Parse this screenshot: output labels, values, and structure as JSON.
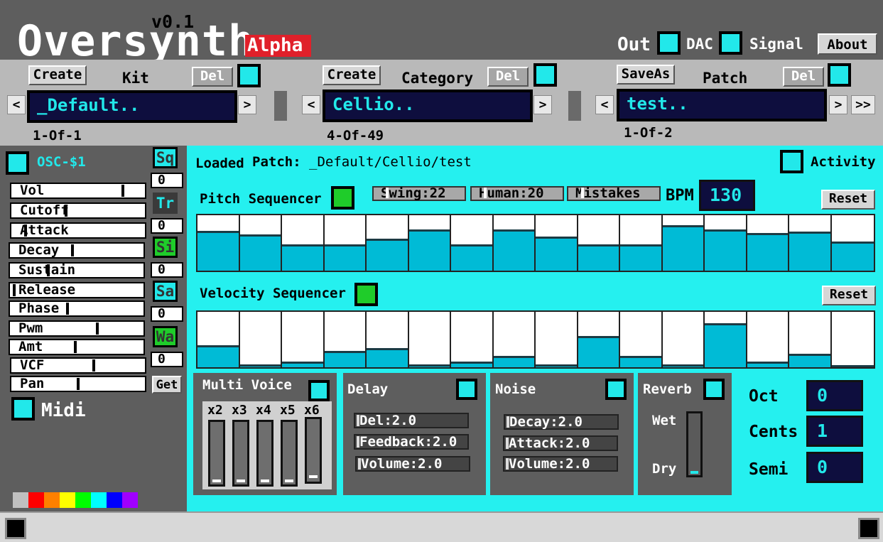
{
  "app": {
    "title": "Oversynth",
    "version": "v0.1",
    "badge": "Alpha"
  },
  "header": {
    "out_label": "Out",
    "dac_label": "DAC",
    "signal_label": "Signal",
    "about_label": "About"
  },
  "kit": {
    "create_label": "Create",
    "label": "Kit",
    "del_label": "Del",
    "prev": "<",
    "next": ">",
    "value": "_Default..",
    "counter": "1-Of-1"
  },
  "category": {
    "create_label": "Create",
    "label": "Category",
    "del_label": "Del",
    "prev": "<",
    "next": ">",
    "value": "Cellio..",
    "counter": "4-Of-49"
  },
  "patch": {
    "saveas_label": "SaveAs",
    "label": "Patch",
    "del_label": "Del",
    "prev": "<",
    "next": ">",
    "last": ">>",
    "value": "test..",
    "counter": "1-Of-2"
  },
  "osc": {
    "label": "OSC-$1",
    "sliders": [
      {
        "label": "Vol",
        "value": 0.84
      },
      {
        "label": "Cutoff",
        "value": 0.41
      },
      {
        "label": "Attack",
        "value": 0.1
      },
      {
        "label": "Decay",
        "value": 0.47
      },
      {
        "label": "Sustain",
        "value": 0.28
      },
      {
        "label": "Release",
        "value": 0.02
      },
      {
        "label": "Phase",
        "value": 0.43
      },
      {
        "label": "Pwm",
        "value": 0.66
      },
      {
        "label": "Amt",
        "value": 0.49
      },
      {
        "label": "VCF",
        "value": 0.62
      },
      {
        "label": "Pan",
        "value": 0.5
      }
    ],
    "waves": [
      {
        "label": "Sq",
        "num": "0"
      },
      {
        "label": "Tr",
        "num": "0"
      },
      {
        "label": "Si",
        "num": "0"
      },
      {
        "label": "Sa",
        "num": "0"
      },
      {
        "label": "Wa",
        "num": "0"
      }
    ],
    "get_label": "Get",
    "midi_label": "Midi",
    "colors": [
      "#c0c0c0",
      "#ff0000",
      "#ff8000",
      "#ffff00",
      "#00ff00",
      "#00ffff",
      "#0000ff",
      "#a000ff"
    ]
  },
  "loaded": {
    "prefix": "Loaded",
    "label": "Patch:",
    "path": "_Default/Cellio/test",
    "activity_label": "Activity"
  },
  "pitch": {
    "label": "Pitch Sequencer",
    "swing": "Swing:22",
    "human": "Human:20",
    "mistakes": "Mistakes",
    "bpm_label": "BPM",
    "bpm_value": "130",
    "reset_label": "Reset",
    "steps": [
      0.72,
      0.66,
      0.48,
      0.48,
      0.58,
      0.74,
      0.48,
      0.74,
      0.62,
      0.48,
      0.48,
      0.82,
      0.74,
      0.68,
      0.7,
      0.52
    ]
  },
  "velocity": {
    "label": "Velocity Sequencer",
    "reset_label": "Reset",
    "steps": [
      0.4,
      0.05,
      0.1,
      0.3,
      0.34,
      0.05,
      0.1,
      0.2,
      0.05,
      0.56,
      0.2,
      0.05,
      0.8,
      0.1,
      0.24,
      0.03
    ]
  },
  "multivoice": {
    "title": "Multi  Voice",
    "voices": [
      {
        "label": "x2",
        "level": 0.03
      },
      {
        "label": "x3",
        "level": 0.03
      },
      {
        "label": "x4",
        "level": 0.03
      },
      {
        "label": "x5",
        "level": 0.03
      },
      {
        "label": "x6",
        "level": 0.06
      }
    ]
  },
  "delay": {
    "title": "Delay",
    "params": [
      "Del:2.0",
      "Feedback:2.0",
      "Volume:2.0"
    ]
  },
  "noise": {
    "title": "Noise",
    "params": [
      "Decay:2.0",
      "Attack:2.0",
      "Volume:2.0"
    ]
  },
  "reverb": {
    "title": "Reverb",
    "wet_label": "Wet",
    "dry_label": "Dry",
    "level": 0.05
  },
  "tuning": {
    "oct_label": "Oct",
    "oct_value": "0",
    "cents_label": "Cents",
    "cents_value": "1",
    "semi_label": "Semi",
    "semi_value": "0"
  }
}
